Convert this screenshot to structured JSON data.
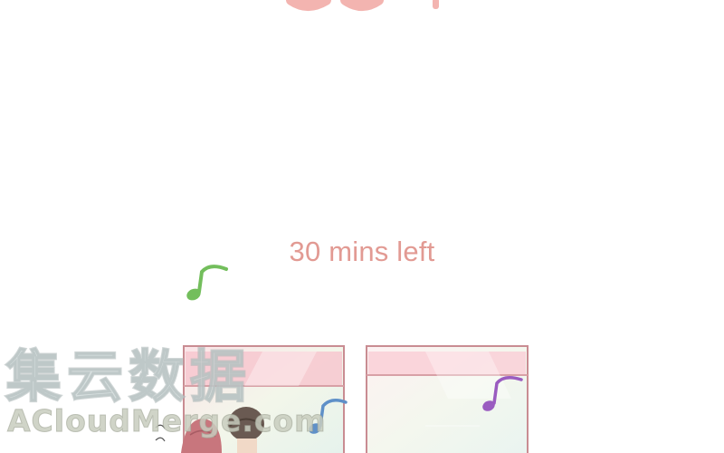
{
  "panel": {
    "caption": "30 mins left"
  },
  "watermark": {
    "chinese": "集云数据",
    "latin": "ACloudMerge.com"
  },
  "colors": {
    "caption": "#e29a93",
    "window_frame": "#c98c92",
    "note_green": "#73be5c",
    "note_blue": "#5f90c8",
    "note_purple": "#9a5cc0"
  }
}
